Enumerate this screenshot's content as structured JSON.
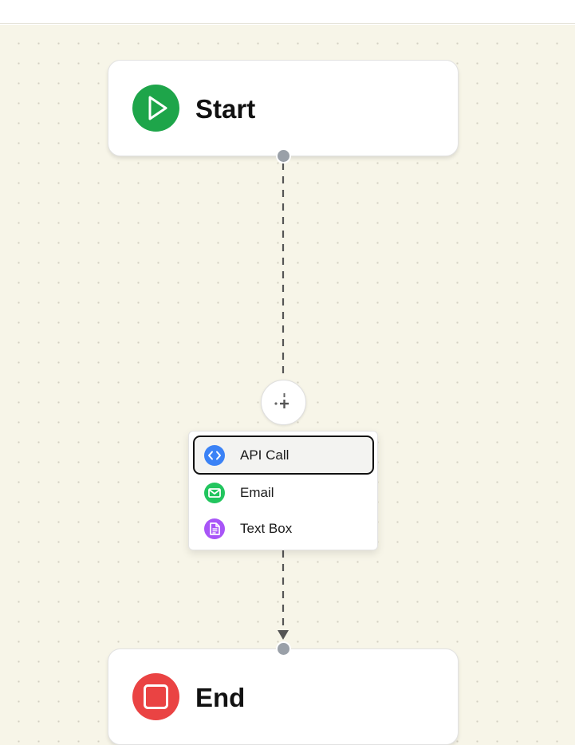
{
  "workflow": {
    "nodes": {
      "start": {
        "title": "Start",
        "icon": "play-icon",
        "color": "#1ea54a"
      },
      "end": {
        "title": "End",
        "icon": "stop-icon",
        "color": "#ea4343"
      }
    },
    "edge": {
      "style": "dashed",
      "color": "#555555"
    },
    "add_button": {
      "icon": "plus-move-icon"
    },
    "add_menu": {
      "items": [
        {
          "label": "API Call",
          "icon": "code-icon",
          "color": "#3b82f6",
          "selected": true
        },
        {
          "label": "Email",
          "icon": "mail-icon",
          "color": "#22c55e",
          "selected": false
        },
        {
          "label": "Text Box",
          "icon": "document-icon",
          "color": "#a855f7",
          "selected": false
        }
      ]
    }
  }
}
